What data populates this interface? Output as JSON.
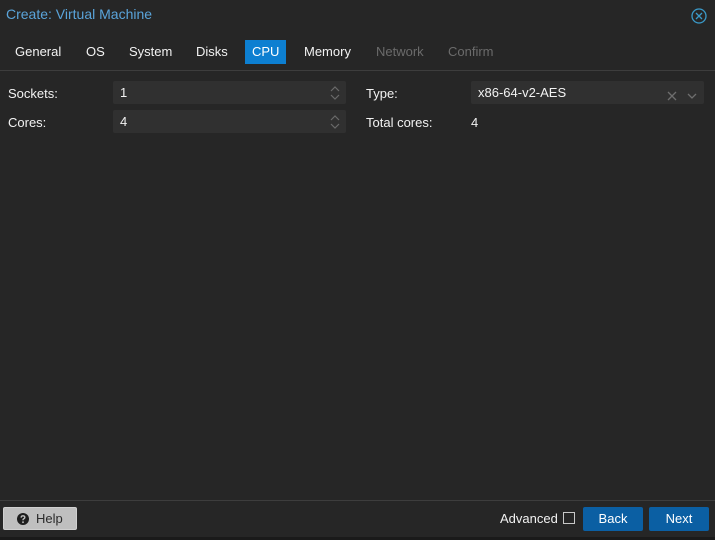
{
  "window": {
    "title": "Create: Virtual Machine",
    "close_icon": "circle-x-icon"
  },
  "tabs": [
    {
      "label": "General",
      "state": "normal"
    },
    {
      "label": "OS",
      "state": "normal"
    },
    {
      "label": "System",
      "state": "normal"
    },
    {
      "label": "Disks",
      "state": "normal"
    },
    {
      "label": "CPU",
      "state": "active"
    },
    {
      "label": "Memory",
      "state": "normal"
    },
    {
      "label": "Network",
      "state": "disabled"
    },
    {
      "label": "Confirm",
      "state": "disabled"
    }
  ],
  "form": {
    "sockets": {
      "label": "Sockets:",
      "value": "1"
    },
    "cores": {
      "label": "Cores:",
      "value": "4"
    },
    "type": {
      "label": "Type:",
      "value": "x86-64-v2-AES"
    },
    "total_cores": {
      "label": "Total cores:",
      "value": "4"
    }
  },
  "footer": {
    "help_label": "Help",
    "advanced_label": "Advanced",
    "advanced_checked": false,
    "back_label": "Back",
    "next_label": "Next"
  },
  "colors": {
    "accent": "#0d7fd1",
    "title": "#5aa4da",
    "button_primary": "#0b5fa3",
    "background": "#262626"
  }
}
